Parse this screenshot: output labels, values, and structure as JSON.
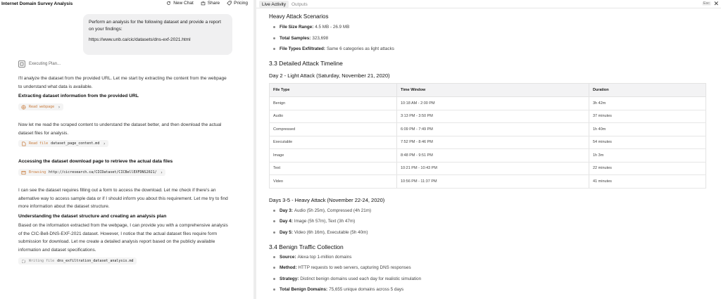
{
  "header": {
    "title": "Internet Domain Survey Analysis",
    "new_chat": "New Chat",
    "share": "Share",
    "pricing": "Pricing"
  },
  "user_message": {
    "line1": "Perform an analysis for the following dataset and provide a report",
    "line2": "on your findings:",
    "url": "https://www.unb.ca/cic/datasets/dns-exf-2021.html"
  },
  "executing_plan": "Executing Plan...",
  "messages": {
    "m1_line1": "I'll analyze the dataset from the provided URL. Let me start by extracting the content from the webpage",
    "m1_line2": "to understand what data is available.",
    "h1": "Extracting dataset information from the provided URL",
    "chip1": {
      "verb": "Read webpage",
      "arg": ""
    },
    "m2_line1": "Now let me read the scraped content to understand the dataset better, and then download the actual",
    "m2_line2": "dataset files for analysis.",
    "chip2": {
      "verb": "Read file",
      "arg": "dataset_page_content.md"
    },
    "h2": "Accessing the dataset download page to retrieve the actual data files",
    "chip3": {
      "verb": "Browsing",
      "arg": "http://cicresearch.ca/CICDataset/CICBellEXFDNS2021/"
    },
    "m3_line1": "I can see the dataset requires filling out a form to access the download. Let me check if there's an",
    "m3_line2": "alternative way to access sample data or if I should inform you about this requirement. Let me try to find",
    "m3_line3": "more information about the dataset structure.",
    "h3": "Understanding the dataset structure and creating an analysis plan",
    "m4_line1": "Based on the information extracted from the webpage, I can provide you with a comprehensive analysis",
    "m4_line2": "of the CIC-Bell-DNS-EXF-2021 dataset. However, I notice that the actual dataset files require form",
    "m4_line3": "submission for download. Let me create a detailed analysis report based on the publicly available",
    "m4_line4": "information and dataset specifications.",
    "chip4": {
      "verb": "Writing file",
      "arg": "dns_exfiltration_dataset_analysis.md"
    }
  },
  "right_tabs": {
    "live": "Live Activity",
    "outputs": "Outputs",
    "esc": "Esc",
    "close": "✕"
  },
  "doc": {
    "heavy_title": "Heavy Attack Scenarios",
    "heavy_bullets": [
      {
        "label": "File Size Range:",
        "value": "4.5 MB - 26.9 MB"
      },
      {
        "label": "Total Samples:",
        "value": "323,698"
      },
      {
        "label": "File Types Exfiltrated:",
        "value": "Same 6 categories as light attacks"
      }
    ],
    "timeline_title": "3.3 Detailed Attack Timeline",
    "day2_title": "Day 2 - Light Attack (Saturday, November 21, 2020)",
    "table": {
      "headers": [
        "File Type",
        "Time Window",
        "Duration"
      ],
      "rows": [
        [
          "Benign",
          "10:18 AM - 2:00 PM",
          "3h 42m"
        ],
        [
          "Audio",
          "3:13 PM - 3:50 PM",
          "37 minutes"
        ],
        [
          "Compressed",
          "6:09 PM - 7:49 PM",
          "1h 40m"
        ],
        [
          "Executable",
          "7:52 PM - 8:46 PM",
          "54 minutes"
        ],
        [
          "Image",
          "8:48 PM - 9:51 PM",
          "1h 3m"
        ],
        [
          "Text",
          "10:21 PM - 10:43 PM",
          "22 minutes"
        ],
        [
          "Video",
          "10:56 PM - 11:37 PM",
          "41 minutes"
        ]
      ]
    },
    "days35_title": "Days 3-5 - Heavy Attack (November 22-24, 2020)",
    "days35_bullets": [
      {
        "label": "Day 3:",
        "value": "Audio (5h 25m), Compressed (4h 21m)"
      },
      {
        "label": "Day 4:",
        "value": "Image (5h 57m), Text (3h 47m)"
      },
      {
        "label": "Day 5:",
        "value": "Video (6h 16m), Executable (5h 40m)"
      }
    ],
    "benign_title": "3.4 Benign Traffic Collection",
    "benign_bullets": [
      {
        "label": "Source:",
        "value": "Alexa top 1-million domains"
      },
      {
        "label": "Method:",
        "value": "HTTP requests to web servers, capturing DNS responses"
      },
      {
        "label": "Strategy:",
        "value": "Distinct benign domains used each day for realistic simulation"
      },
      {
        "label": "Total Benign Domains:",
        "value": "75,655 unique domains across 5 days"
      }
    ]
  }
}
